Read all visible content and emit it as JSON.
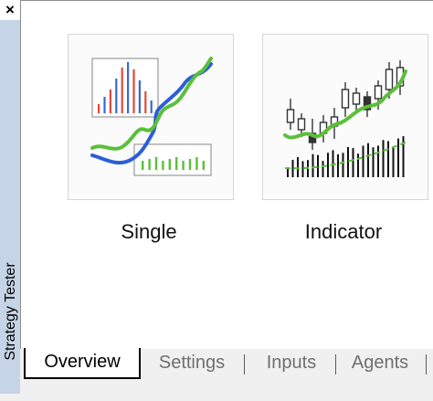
{
  "panel": {
    "title": "Strategy Tester",
    "close_glyph": "×"
  },
  "modes": [
    {
      "label": "Single",
      "icon": "single-test-chart-icon"
    },
    {
      "label": "Indicator",
      "icon": "indicator-chart-icon"
    }
  ],
  "tabs": [
    {
      "label": "Overview",
      "active": true
    },
    {
      "label": "Settings",
      "active": false
    },
    {
      "label": "Inputs",
      "active": false
    },
    {
      "label": "Agents",
      "active": false
    }
  ],
  "colors": {
    "accent_green": "#5cbf3a",
    "accent_blue": "#2b5fd6",
    "bar_red": "#e04a3a",
    "bar_blue": "#3a66d8",
    "candle_dark": "#333333"
  }
}
